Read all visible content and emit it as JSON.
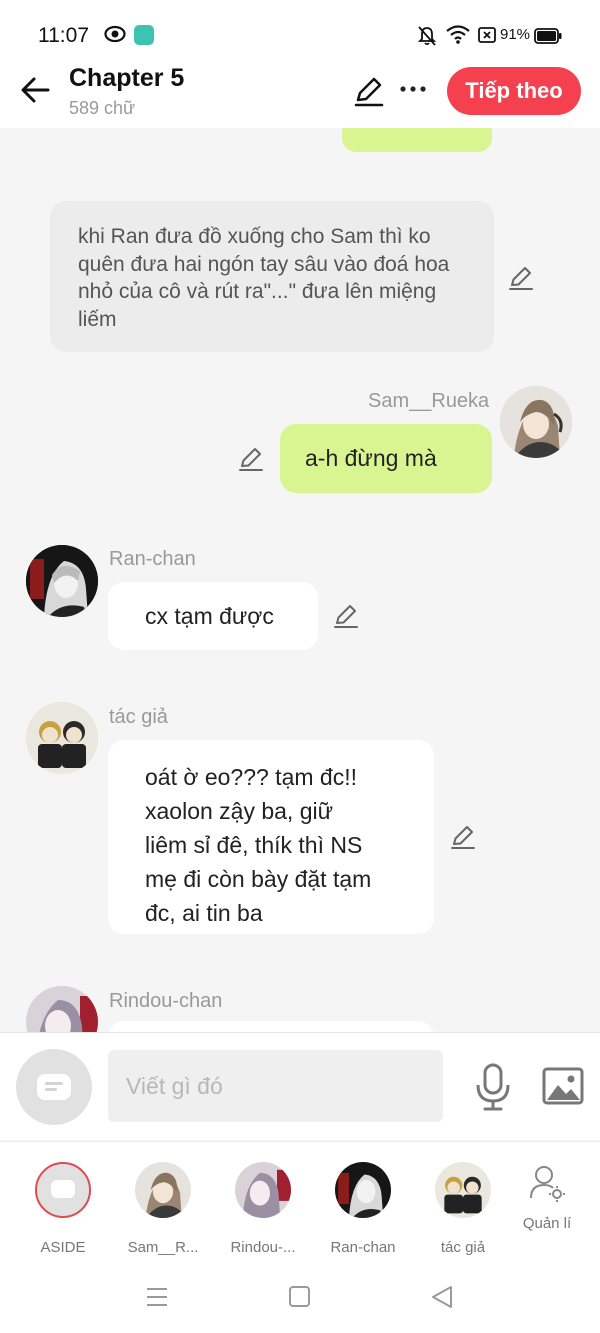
{
  "status": {
    "time": "11:07",
    "battery": "91%"
  },
  "header": {
    "title": "Chapter 5",
    "word_count": "589 chữ",
    "next_button": "Tiếp theo"
  },
  "messages": [
    {
      "type": "narration",
      "text": "khi Ran đưa đồ xuống cho Sam thì ko quên đưa hai ngón tay sâu vào đoá hoa nhỏ của cô và rút ra\"...\" đưa lên miệng liếm"
    },
    {
      "type": "self",
      "sender": "Sam__Rueka",
      "text": "a-h đừng mà"
    },
    {
      "type": "other",
      "sender": "Ran-chan",
      "text": "cx tạm được"
    },
    {
      "type": "other",
      "sender": "tác giả",
      "lines": [
        "oát ờ eo??? tạm đc!!",
        "xaolon zậy ba, giữ",
        "liêm sỉ đê, thík thì NS",
        "mẹ đi còn bày đặt tạm",
        "đc, ai tin ba"
      ]
    },
    {
      "type": "other",
      "sender": "Rindou-chan",
      "text": ""
    }
  ],
  "composer": {
    "placeholder": "Viết gì đó"
  },
  "characters": [
    {
      "label": "ASIDE",
      "icon": "aside-icon",
      "selected": true
    },
    {
      "label": "Sam__R...",
      "icon": "avatar-sam"
    },
    {
      "label": "Rindou-...",
      "icon": "avatar-rindou"
    },
    {
      "label": "Ran-chan",
      "icon": "avatar-ran"
    },
    {
      "label": "tác giả",
      "icon": "avatar-author"
    }
  ],
  "manage_label": "Quản lí",
  "colors": {
    "accent": "#f5414f",
    "self_bubble": "#d9f592",
    "narration_bubble": "#ececec",
    "other_bubble": "#ffffff",
    "background": "#f5f5f5"
  }
}
